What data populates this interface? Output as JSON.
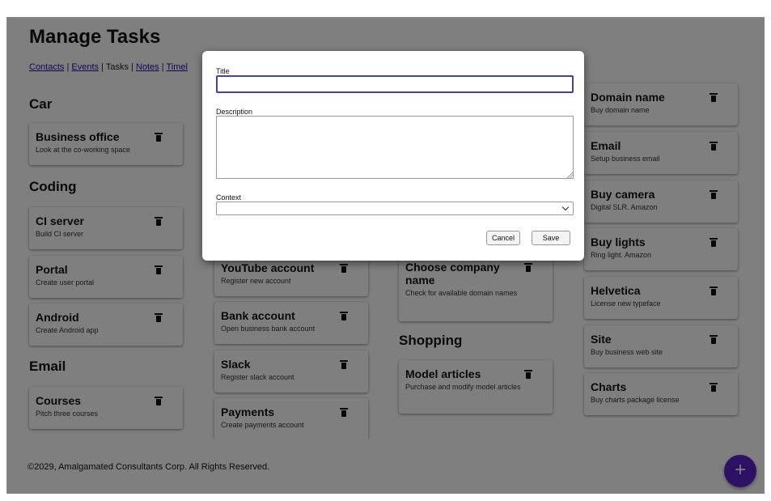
{
  "page": {
    "title": "Manage Tasks",
    "nav": {
      "contacts": "Contacts",
      "events": "Events",
      "tasks": "Tasks",
      "notes": "Notes",
      "timeline_partial": "Timel",
      "separator": "|"
    },
    "footer": "©2029, Amalgamated Consultants Corp. All Rights Reserved.",
    "fab_label": "+"
  },
  "columns": [
    {
      "groups": [
        {
          "title": "Car",
          "cards": [
            {
              "title": "Business office",
              "desc": "Look at the co-working space"
            }
          ]
        },
        {
          "title": "Coding",
          "cards": [
            {
              "title": "CI server",
              "desc": "Build CI server"
            },
            {
              "title": "Portal",
              "desc": "Create user portal"
            },
            {
              "title": "Android",
              "desc": "Create Android app"
            }
          ]
        },
        {
          "title": "Email",
          "cards": [
            {
              "title": "Courses",
              "desc": "Pitch three courses"
            }
          ]
        }
      ]
    },
    {
      "cards": [
        {
          "title": "YouTube account",
          "desc": "Register new account"
        },
        {
          "title": "Bank account",
          "desc": "Open business bank account"
        },
        {
          "title": "Slack",
          "desc": "Register slack account"
        },
        {
          "title": "Payments",
          "desc": "Create payments account"
        }
      ]
    },
    {
      "cards": [
        {
          "title": "Choose company name",
          "desc": "Check for available domain names"
        }
      ],
      "groups": [
        {
          "title": "Shopping",
          "cards": [
            {
              "title": "Model articles",
              "desc": "Purchase and modify model articles"
            }
          ]
        }
      ]
    },
    {
      "cards": [
        {
          "title": "Domain name",
          "desc": "Buy domain name"
        },
        {
          "title": "Email",
          "desc": "Setup business email"
        },
        {
          "title": "Buy camera",
          "desc": "Digital SLR. Amazon"
        },
        {
          "title": "Buy lights",
          "desc": "Ring light. Amazon"
        },
        {
          "title": "Helvetica",
          "desc": "License new typeface"
        },
        {
          "title": "Site",
          "desc": "Buy business web site"
        },
        {
          "title": "Charts",
          "desc": "Buy charts package license"
        }
      ]
    }
  ],
  "dialog": {
    "title_label": "Title",
    "title_value": "",
    "description_label": "Description",
    "description_value": "",
    "context_label": "Context",
    "context_value": "",
    "cancel_label": "Cancel",
    "save_label": "Save"
  },
  "colors": {
    "accent": "#5b23c9",
    "focus_border": "#3b3fc0",
    "overlay": "#000000"
  }
}
